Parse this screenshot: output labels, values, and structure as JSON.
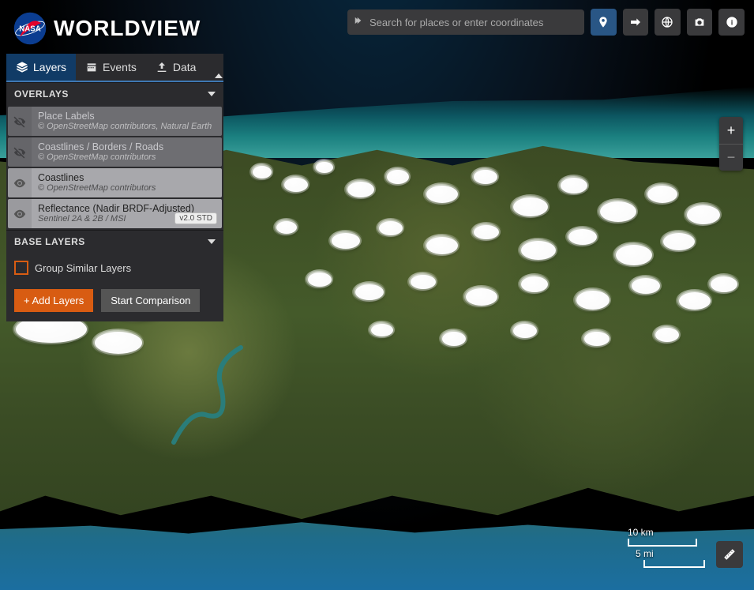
{
  "app": {
    "name": "WORLDVIEW",
    "agency": "NASA"
  },
  "search": {
    "placeholder": "Search for places or enter coordinates"
  },
  "tabs": {
    "layers": "Layers",
    "events": "Events",
    "data": "Data"
  },
  "sections": {
    "overlays": "OVERLAYS",
    "base_layers": "BASE LAYERS"
  },
  "overlays": [
    {
      "title": "Place Labels",
      "sub": "© OpenStreetMap contributors, Natural Earth",
      "visible": false
    },
    {
      "title": "Coastlines / Borders / Roads",
      "sub": "© OpenStreetMap contributors",
      "visible": false
    },
    {
      "title": "Coastlines",
      "sub": "© OpenStreetMap contributors",
      "visible": true
    },
    {
      "title": "Reflectance (Nadir BRDF-Adjusted)",
      "sub": "Sentinel 2A & 2B / MSI",
      "visible": true,
      "badge": "v2.0 STD"
    }
  ],
  "group_similar": {
    "label": "Group Similar Layers",
    "checked": false
  },
  "buttons": {
    "add_layers": "+ Add Layers",
    "compare": "Start Comparison"
  },
  "scale": {
    "km": "10 km",
    "mi": "5 mi"
  },
  "zoom": {
    "in": "+",
    "out": "−"
  }
}
